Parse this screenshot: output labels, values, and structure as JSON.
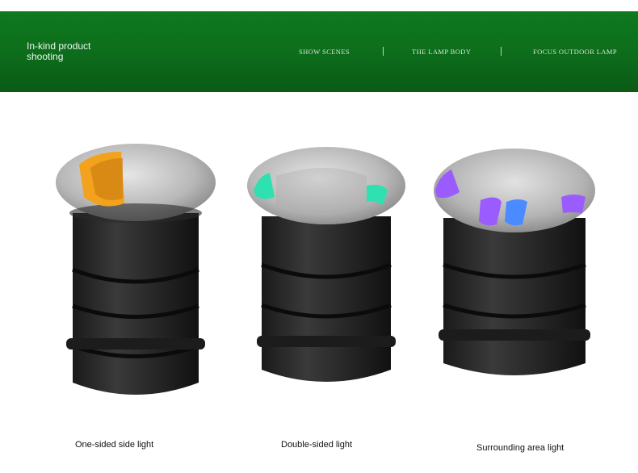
{
  "banner": {
    "title": "In-kind product shooting",
    "nav": [
      "SHOW SCENES",
      "THE LAMP BODY",
      "FOCUS OUTDOOR LAMP"
    ],
    "color": "#0d6c1b"
  },
  "products": [
    {
      "caption": "One-sided side light",
      "light_color": "#f2a21c",
      "openings": 1
    },
    {
      "caption": "Double-sided light",
      "light_color": "#2fe0b0",
      "openings": 2
    },
    {
      "caption": "Surrounding area light",
      "light_color": "#9a5cff",
      "openings": 4
    }
  ]
}
